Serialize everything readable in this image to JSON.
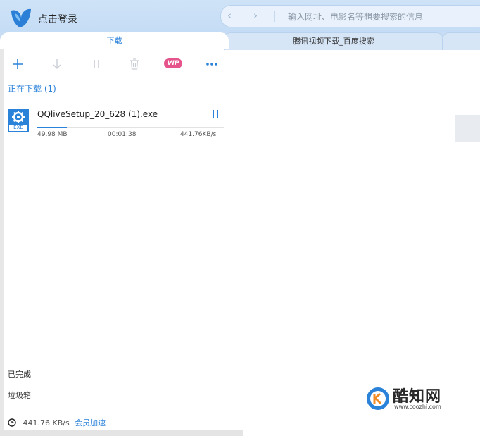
{
  "header": {
    "login_label": "点击登录",
    "back_icon": "chevron-left-icon",
    "forward_icon": "chevron-right-icon",
    "address_placeholder": "输入网址、电影名等想要搜索的信息"
  },
  "tabs": [
    {
      "label": "下载",
      "active": true
    },
    {
      "label": "腾讯视频下载_百度搜索",
      "active": false
    },
    {
      "label": "",
      "active": false
    }
  ],
  "toolbar": {
    "add_icon": "plus-icon",
    "download_icon": "arrow-down-icon",
    "pause_icon": "pause-icon",
    "delete_icon": "trash-icon",
    "vip_label": "VIP",
    "more_icon": "more-icon"
  },
  "downloading": {
    "title": "正在下载 (1)",
    "items": [
      {
        "file_type": "EXE",
        "name": "QQliveSetup_20_628 (1).exe",
        "size": "49.98 MB",
        "remaining": "00:01:38",
        "speed": "441.76KB/s",
        "progress": 0.16
      }
    ]
  },
  "sidebar": {
    "completed": "已完成",
    "trash": "垃圾箱"
  },
  "status": {
    "speed": "441.76 KB/s",
    "vip_boost": "会员加速"
  },
  "watermark": {
    "name": "酷知网",
    "url": "www.coozhi.com"
  },
  "colors": {
    "accent": "#2b82d9",
    "topbar": "#c4dcf5",
    "vip": "#e6548c"
  }
}
